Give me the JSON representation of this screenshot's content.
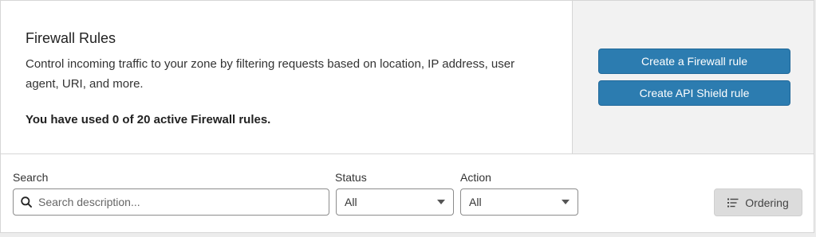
{
  "header": {
    "title": "Firewall Rules",
    "description": "Control incoming traffic to your zone by filtering requests based on location, IP address, user agent, URI, and more.",
    "usage": "You have used 0 of 20 active Firewall rules."
  },
  "actions": {
    "create_firewall_rule": "Create a Firewall rule",
    "create_api_shield_rule": "Create API Shield rule"
  },
  "filters": {
    "search": {
      "label": "Search",
      "placeholder": "Search description...",
      "value": ""
    },
    "status": {
      "label": "Status",
      "selected": "All"
    },
    "action": {
      "label": "Action",
      "selected": "All"
    },
    "ordering_label": "Ordering"
  },
  "colors": {
    "primary_button": "#2c7cb0",
    "panel_background": "#f2f2f2",
    "secondary_button": "#dcdcdc"
  },
  "icons": {
    "search": "search-icon",
    "ordering": "list-ordering-icon",
    "dropdown": "caret-down-icon"
  }
}
